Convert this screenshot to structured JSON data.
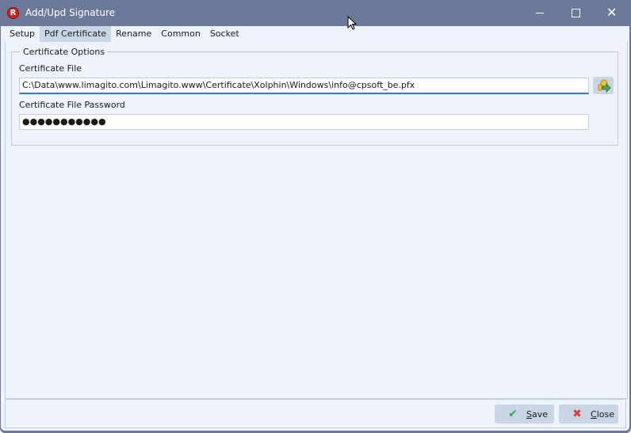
{
  "window": {
    "title": "Add/Upd Signature",
    "app_icon_letter": "R",
    "controls": {
      "minimize": "minimize",
      "maximize": "maximize",
      "close": "close"
    }
  },
  "tabs": [
    {
      "label": "Setup",
      "active": false
    },
    {
      "label": "Pdf Certificate",
      "active": true
    },
    {
      "label": "Rename",
      "active": false
    },
    {
      "label": "Common",
      "active": false
    },
    {
      "label": "Socket",
      "active": false
    }
  ],
  "certificate_options": {
    "group_title": "Certificate Options",
    "file_label": "Certificate File",
    "file_value": "C:\\Data\\www.limagito.com\\Limagito.www\\Certificate\\Xolphin\\Windows\\info@cpsoft_be.pfx",
    "browse_icon": "folder-open-key-icon",
    "password_label": "Certificate File Password",
    "password_value": "●●●●●●●●●●●"
  },
  "footer": {
    "save": {
      "label": "Save",
      "mnemonic": "S",
      "rest": "ave",
      "icon": "check-icon",
      "icon_color": "#3fa34d"
    },
    "close": {
      "label": "Close",
      "mnemonic": "C",
      "rest": "lose",
      "icon": "x-icon",
      "icon_color": "#e03a3a"
    }
  }
}
